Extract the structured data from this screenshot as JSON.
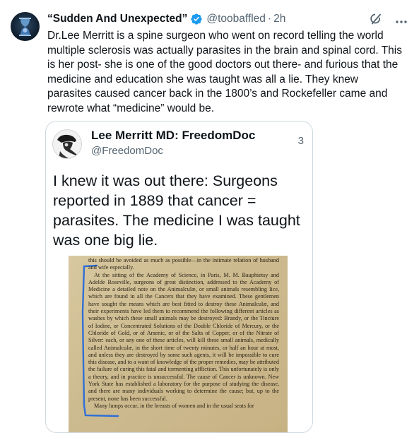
{
  "post": {
    "author_name": "“Sudden And Unexpected”",
    "handle": "@toobaffled",
    "separator": "·",
    "time": "2h",
    "body": "Dr.Lee Merritt is a spine surgeon who went on record telling the world multiple sclerosis was actually parasites in the brain and spinal cord. This is her post- she is one of the good doctors out there- and furious that the medicine and education she was taught was all a lie. They knew parasites caused cancer back in the 1800’s and Rockefeller came and rewrote what “medicine” would be.",
    "icons": {
      "verified": "verified-badge-icon",
      "grok": "grok-icon",
      "more": "more-icon"
    }
  },
  "quote": {
    "name": "Lee Merritt MD: FreedomDoc",
    "handle": "@FreedomDoc",
    "number": "3",
    "text": "I knew it was out there: Surgeons reported in 1889 that cancer = parasites. The medicine I was taught was one big lie.",
    "document": {
      "lines": [
        "this should be avoided as much as possible—in the intimate relation of husband and wife especially.",
        "At the sitting of the Academy of Science, in Paris, M. M. Bauphietsy and Adelde Roseville, surgeons of great distinction, addressed to the Academy of Medicine a detailed note on the Animalculæ, or small animals resembling lice, which are found in all the Cancers that they have examined. These gentlemen have sought the means which are best fitted to destroy these Animalculæ, and their experiments have led them to recommend the following different articles as washes by which these small animals may be destroyed: Brandy, or the Tincture of Iodine, or Concentrated Solutions of the Double Chloride of Mercury, or the Chloride of Gold, or of Arsenic, or of the Salts of Copper, or of the Nitrate of Silver: each, or any one of these articles, will kill these small animals, medically called Animalculæ, in the short time of twenty minutes, or half an hour at most, and unless they are destroyed by some such agents, it will be impossible to cure this disease, and to a want of knowledge of the proper remedies, may be attributed the failure of curing this fatal and tormenting affliction. This unfortunately is only a theory, and in practice is unsuccessful. The cause of Cancer is unknown. New York State has established a laboratory for the purpose of studying the disease, and there are many individuals working to determine the cause; but, up to the present, none has been successful.",
        "Many lumps occur, in the breasts of women and in the usual seats for"
      ]
    }
  }
}
